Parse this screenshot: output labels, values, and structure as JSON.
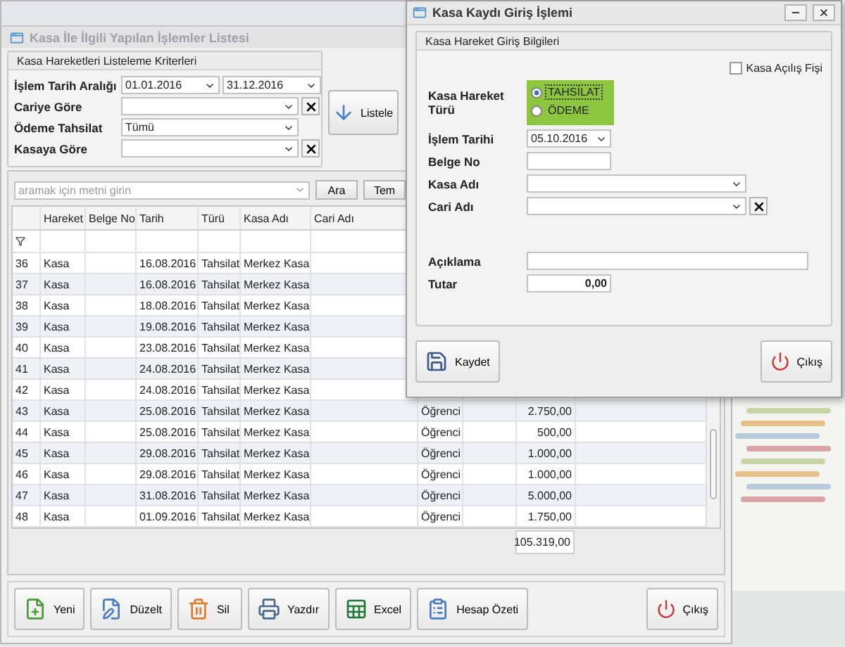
{
  "main_window": {
    "title": "Kasa İle İlgili Yapılan İşlemler Listesi",
    "criteria": {
      "title": "Kasa Hareketleri Listeleme Kriterleri",
      "fields": [
        {
          "label": "İşlem Tarih Aralığı",
          "kind": "range",
          "values": [
            "01.01.2016",
            "31.12.2016"
          ]
        },
        {
          "label": "Cariye Göre",
          "kind": "clearable"
        },
        {
          "label": "Ödeme Tahsilat",
          "kind": "select",
          "value": "Tümü"
        },
        {
          "label": "Kasaya Göre",
          "kind": "clearable"
        }
      ]
    },
    "list_button": "Listele",
    "search": {
      "placeholder": "aramak için metni girin",
      "buttons": [
        "Ara",
        "Tem"
      ]
    },
    "table": {
      "columns": [
        "Hareket",
        "Belge No",
        "Tarih",
        "Türü",
        "Kasa Adı",
        "Cari Adı"
      ],
      "rows": [
        {
          "no": "36",
          "hareket": "Kasa",
          "tarih": "16.08.2016",
          "turu": "Tahsilat",
          "kasa": "Merkez Kasa"
        },
        {
          "no": "37",
          "hareket": "Kasa",
          "tarih": "16.08.2016",
          "turu": "Tahsilat",
          "kasa": "Merkez Kasa"
        },
        {
          "no": "38",
          "hareket": "Kasa",
          "tarih": "18.08.2016",
          "turu": "Tahsilat",
          "kasa": "Merkez Kasa"
        },
        {
          "no": "39",
          "hareket": "Kasa",
          "tarih": "19.08.2016",
          "turu": "Tahsilat",
          "kasa": "Merkez Kasa"
        },
        {
          "no": "40",
          "hareket": "Kasa",
          "tarih": "23.08.2016",
          "turu": "Tahsilat",
          "kasa": "Merkez Kasa"
        },
        {
          "no": "41",
          "hareket": "Kasa",
          "tarih": "24.08.2016",
          "turu": "Tahsilat",
          "kasa": "Merkez Kasa"
        },
        {
          "no": "42",
          "hareket": "Kasa",
          "tarih": "24.08.2016",
          "turu": "Tahsilat",
          "kasa": "Merkez Kasa"
        },
        {
          "no": "43",
          "hareket": "Kasa",
          "tarih": "25.08.2016",
          "turu": "Tahsilat",
          "kasa": "Merkez Kasa",
          "column_8": "Öğrenci",
          "amount": "2.750,00"
        },
        {
          "no": "44",
          "hareket": "Kasa",
          "tarih": "25.08.2016",
          "turu": "Tahsilat",
          "kasa": "Merkez Kasa",
          "column_8": "Öğrenci",
          "amount": "500,00"
        },
        {
          "no": "45",
          "hareket": "Kasa",
          "tarih": "29.08.2016",
          "turu": "Tahsilat",
          "kasa": "Merkez Kasa",
          "column_8": "Öğrenci",
          "amount": "1.000,00"
        },
        {
          "no": "46",
          "hareket": "Kasa",
          "tarih": "29.08.2016",
          "turu": "Tahsilat",
          "kasa": "Merkez Kasa",
          "column_8": "Öğrenci",
          "amount": "1.000,00"
        },
        {
          "no": "47",
          "hareket": "Kasa",
          "tarih": "31.08.2016",
          "turu": "Tahsilat",
          "kasa": "Merkez Kasa",
          "column_8": "Öğrenci",
          "amount": "5.000,00"
        },
        {
          "no": "48",
          "hareket": "Kasa",
          "tarih": "01.09.2016",
          "turu": "Tahsilat",
          "kasa": "Merkez Kasa",
          "column_8": "Öğrenci",
          "amount": "1.750,00"
        }
      ],
      "total": "105.319,00"
    },
    "buttons": [
      {
        "label": "Yeni",
        "kind": "new"
      },
      {
        "label": "Düzelt",
        "kind": "edit"
      },
      {
        "label": "Sil",
        "kind": "delete"
      },
      {
        "label": "Yazdır",
        "kind": "print"
      },
      {
        "label": "Excel",
        "kind": "excel"
      },
      {
        "label": "Hesap Özeti",
        "kind": "summary"
      }
    ],
    "exit_button": "Çıkış"
  },
  "dialog": {
    "title": "Kasa Kaydı Giriş İşlemi",
    "group_title": "Kasa Hareket Giriş Bilgileri",
    "opening_checkbox": {
      "label": "Kasa Açılış Fişi",
      "checked": false
    },
    "movement_type": {
      "label": "Kasa Hareket Türü",
      "options": [
        {
          "label": "TAHSİLAT",
          "selected": true
        },
        {
          "label": "ÖDEME",
          "selected": false
        }
      ]
    },
    "fields": [
      {
        "label": "İşlem Tarihi",
        "kind": "date",
        "value": "05.10.2016"
      },
      {
        "label": "Belge No",
        "kind": "text"
      },
      {
        "label": "Kasa Adı",
        "kind": "select"
      },
      {
        "label": "Cari Adı",
        "kind": "clearable"
      },
      {
        "label": "Açıklama",
        "kind": "wide"
      },
      {
        "label": "Tutar",
        "kind": "number",
        "value": "0,00"
      }
    ],
    "save_button": "Kaydet",
    "exit_button": "Çıkış"
  }
}
